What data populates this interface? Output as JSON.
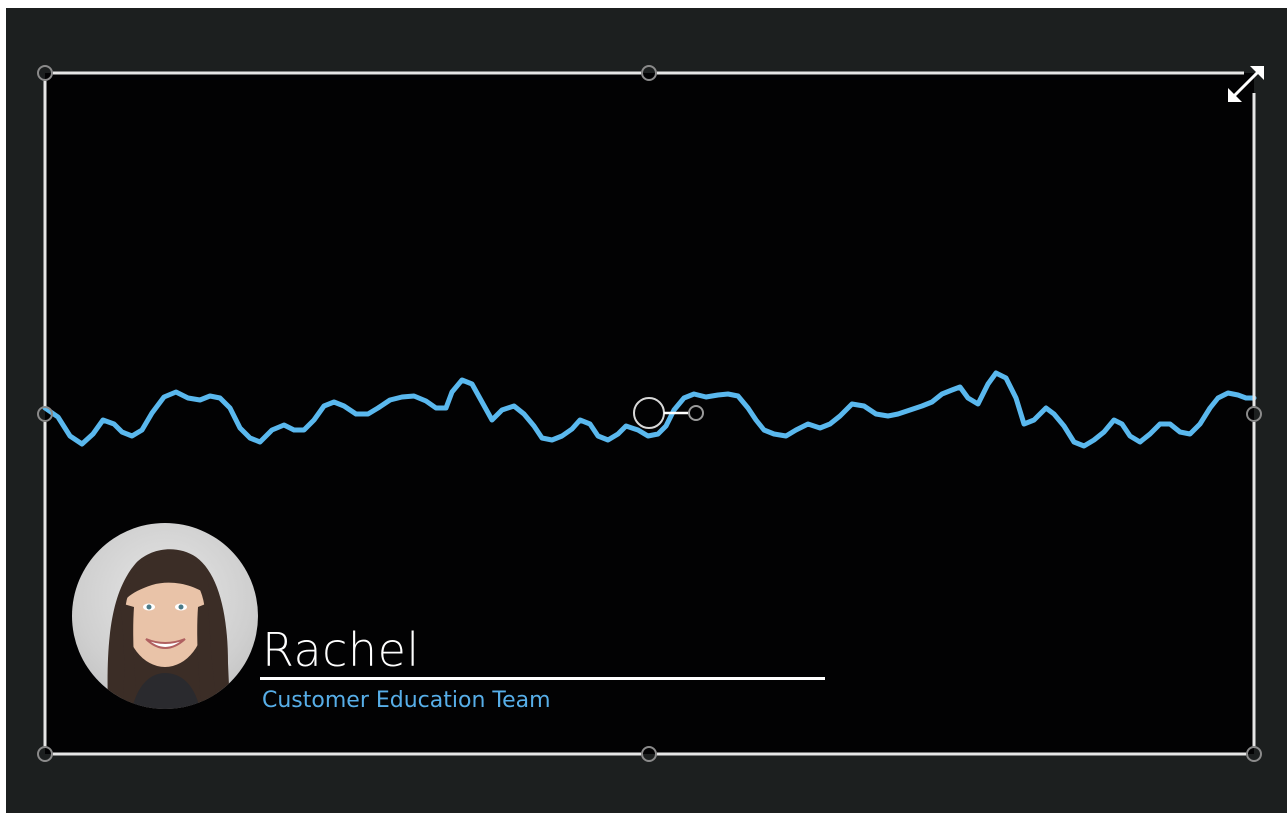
{
  "lower_third": {
    "name": "Rachel",
    "title": "Customer Education Team"
  },
  "colors": {
    "stage_background": "#1c1f1f",
    "canvas_background": "#020203",
    "waveform": "#5ab8ee",
    "name_text": "#ffffff",
    "title_text": "#57aee8",
    "selection_frame": "#e6e6e6"
  },
  "icons": {
    "expand": "expand-arrows-icon",
    "rotation": "rotate-handle-icon"
  }
}
